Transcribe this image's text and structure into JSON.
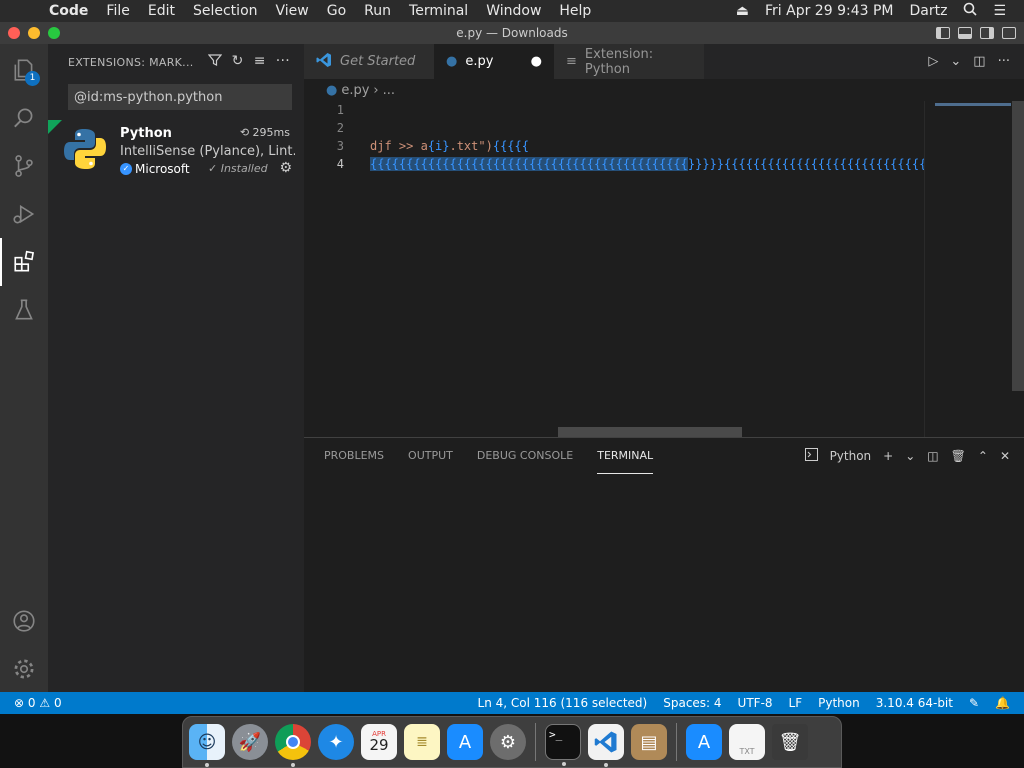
{
  "menubar": {
    "items": [
      "Code",
      "File",
      "Edit",
      "Selection",
      "View",
      "Go",
      "Run",
      "Terminal",
      "Window",
      "Help"
    ],
    "datetime": "Fri Apr 29  9:43 PM",
    "user": "Dartz"
  },
  "window": {
    "title": "e.py — Downloads"
  },
  "activity": {
    "explorer_badge": "1"
  },
  "sidebar": {
    "header": "EXTENSIONS: MARK...",
    "search_value": "@id:ms-python.python",
    "extension": {
      "name": "Python",
      "time": "295ms",
      "description": "IntelliSense (Pylance), Lint...",
      "publisher": "Microsoft",
      "status": "Installed"
    }
  },
  "tabs": [
    {
      "label": "Get Started"
    },
    {
      "label": "e.py",
      "modified_marker": "●"
    },
    {
      "label": "Extension: Python"
    }
  ],
  "breadcrumb": {
    "file": "e.py",
    "rest": "..."
  },
  "editor": {
    "line_numbers": [
      "1",
      "2",
      "3",
      "4"
    ],
    "line3_string": "djf >> a",
    "line3_mid": "{i}",
    "line3_end": ".txt\")",
    "line3_braces": "{{{{{",
    "line4_selected": "{{{{{{{{{{{{{{{{{{{{{{{{{{{{{{{{{{{{{{{{{{{{",
    "line4_rest": "}}}}}{{{{{{{{{{{{{{{{{{{{{{{{{{{{{{{{{{{{{{{"
  },
  "panel": {
    "tabs": [
      "PROBLEMS",
      "OUTPUT",
      "DEBUG CONSOLE",
      "TERMINAL"
    ],
    "active_tab": "TERMINAL",
    "terminal_name": "Python"
  },
  "statusbar": {
    "errors": "0",
    "warnings": "0",
    "cursor": "Ln 4, Col 116 (116 selected)",
    "spaces": "Spaces: 4",
    "encoding": "UTF-8",
    "eol": "LF",
    "language": "Python",
    "interpreter": "3.10.4 64-bit"
  },
  "dock": {
    "calendar_month": "APR",
    "calendar_day": "29"
  }
}
